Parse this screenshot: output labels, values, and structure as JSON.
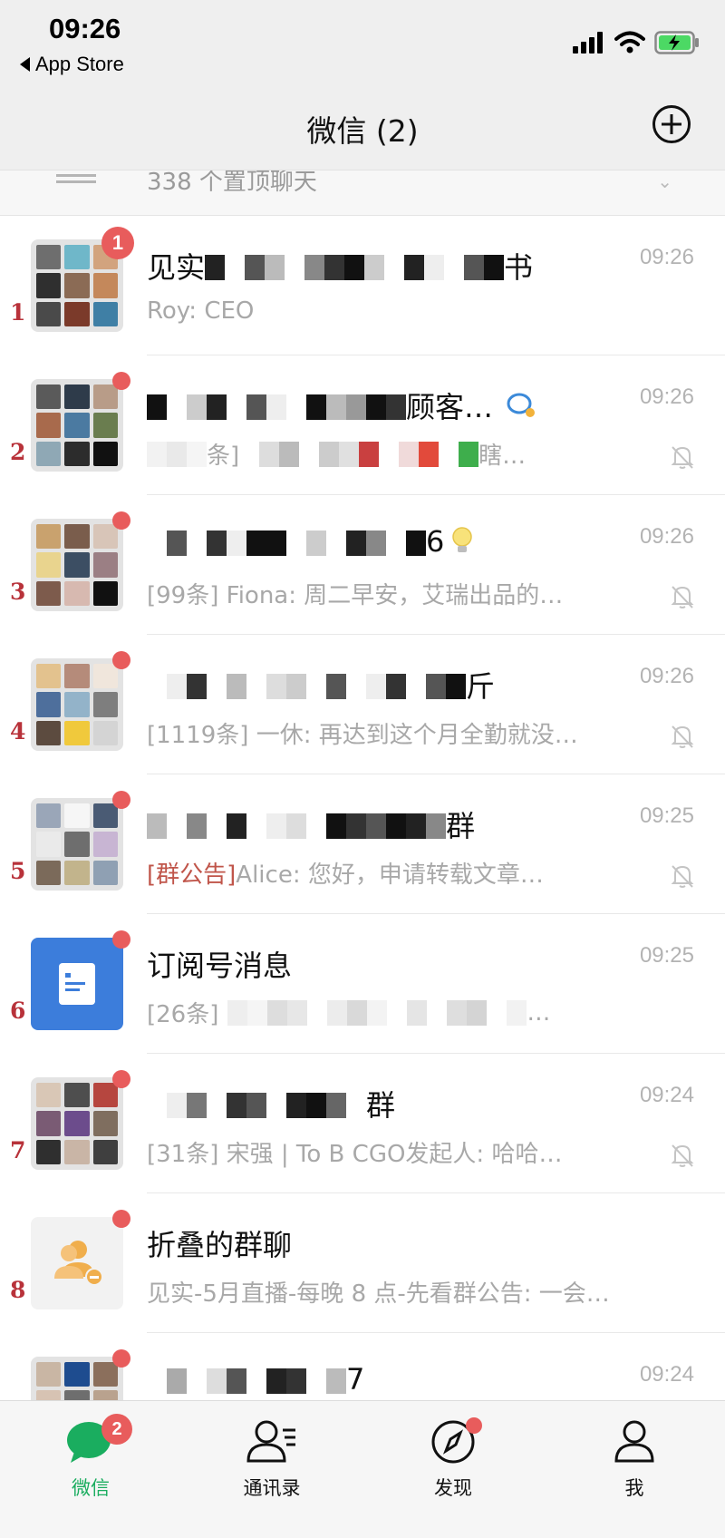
{
  "status_bar": {
    "time": "09:26",
    "back_label": "App Store"
  },
  "header": {
    "title": "微信 (2)",
    "pinned_text": "338 个置顶聊天"
  },
  "colors": {
    "accent": "#1aad5f",
    "badge": "#e85c5c",
    "notice": "#c0554a"
  },
  "chats": [
    {
      "num": "1",
      "name_a": "见实",
      "name_b": "书",
      "time": "09:26",
      "preview": "Roy: CEO",
      "badge": "1"
    },
    {
      "num": "2",
      "name_b": "顾客…",
      "time": "09:26",
      "preview_a": "条]",
      "preview_b": "瞎…"
    },
    {
      "num": "3",
      "name_b": "6",
      "time": "09:26",
      "preview": "[99条] Fiona: 周二早安，艾瑞出品的…"
    },
    {
      "num": "4",
      "name_b": "斤",
      "time": "09:26",
      "preview": "[1119条] 一休: 再达到这个月全勤就没…"
    },
    {
      "num": "5",
      "name_b": "群",
      "time": "09:25",
      "preview_notice": "[群公告]",
      "preview": "Alice: 您好，申请转载文章…"
    },
    {
      "num": "6",
      "name": "订阅号消息",
      "time": "09:25",
      "preview_a": "[26条]",
      "preview_b": "…"
    },
    {
      "num": "7",
      "name_b": "群",
      "time": "09:24",
      "preview": "[31条] 宋强 | To B CGO发起人: 哈哈…"
    },
    {
      "num": "8",
      "name": "折叠的群聊",
      "preview": "见实-5月直播-每晚 8 点-先看群公告: 一会…"
    },
    {
      "name_b": "7",
      "time": "09:24"
    }
  ],
  "tabbar": {
    "tabs": [
      {
        "label": "微信",
        "badge": "2"
      },
      {
        "label": "通讯录"
      },
      {
        "label": "发现"
      },
      {
        "label": "我"
      }
    ]
  }
}
